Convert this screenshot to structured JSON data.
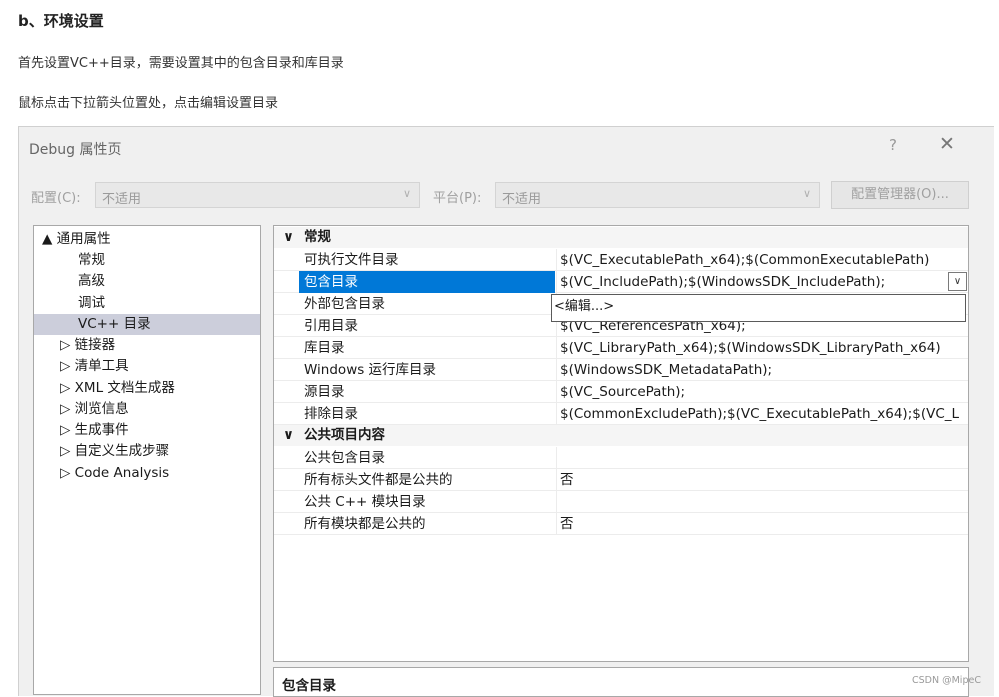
{
  "article": {
    "heading": "b、环境设置",
    "para1": "首先设置VC++目录，需要设置其中的包含目录和库目录",
    "para2": "鼠标点击下拉箭头位置处，点击编辑设置目录"
  },
  "dialog": {
    "title": "Debug 属性页",
    "help": "?",
    "close": "✕",
    "config_label": "配置(C):",
    "config_value": "不适用",
    "platform_label": "平台(P):",
    "platform_value": "不适用",
    "config_manager": "配置管理器(O)..."
  },
  "tree": [
    {
      "label": "▲ 通用属性"
    },
    {
      "label": "常规"
    },
    {
      "label": "高级"
    },
    {
      "label": "调试"
    },
    {
      "label": "VC++ 目录"
    },
    {
      "label": "▷ 链接器"
    },
    {
      "label": "▷ 清单工具"
    },
    {
      "label": "▷ XML 文档生成器"
    },
    {
      "label": "▷ 浏览信息"
    },
    {
      "label": "▷ 生成事件"
    },
    {
      "label": "▷ 自定义生成步骤"
    },
    {
      "label": "▷ Code Analysis"
    }
  ],
  "grid": {
    "section1": {
      "toggle": "∨",
      "label": "常规"
    },
    "rows1": [
      {
        "name": "可执行文件目录",
        "value": "$(VC_ExecutablePath_x64);$(CommonExecutablePath)"
      },
      {
        "name": "包含目录",
        "value": "$(VC_IncludePath);$(WindowsSDK_IncludePath);"
      },
      {
        "name": "外部包含目录",
        "value": ""
      },
      {
        "name": "引用目录",
        "value": "$(VC_ReferencesPath_x64);"
      },
      {
        "name": "库目录",
        "value": "$(VC_LibraryPath_x64);$(WindowsSDK_LibraryPath_x64)"
      },
      {
        "name": "Windows 运行库目录",
        "value": "$(WindowsSDK_MetadataPath);"
      },
      {
        "name": "源目录",
        "value": "$(VC_SourcePath);"
      },
      {
        "name": "排除目录",
        "value": "$(CommonExcludePath);$(VC_ExecutablePath_x64);$(VC_L"
      }
    ],
    "section2": {
      "toggle": "∨",
      "label": "公共项目内容"
    },
    "rows2": [
      {
        "name": "公共包含目录",
        "value": ""
      },
      {
        "name": "所有标头文件都是公共的",
        "value": "否"
      },
      {
        "name": "公共 C++ 模块目录",
        "value": ""
      },
      {
        "name": "所有模块都是公共的",
        "value": "否"
      }
    ],
    "dropdown_arrow": "∨",
    "popup_item": "<编辑...>"
  },
  "description": {
    "title": "包含目录"
  },
  "watermark": "CSDN @MipeC"
}
